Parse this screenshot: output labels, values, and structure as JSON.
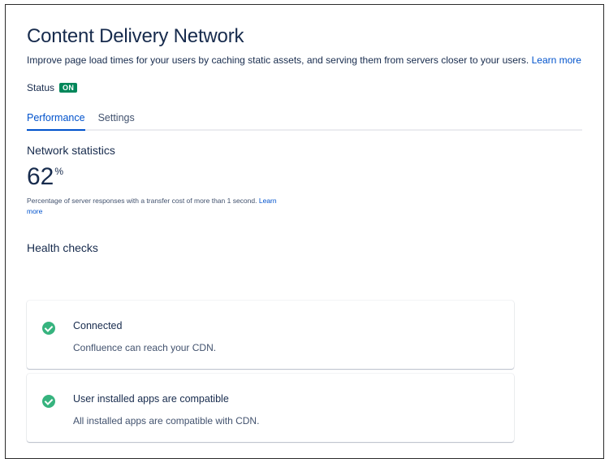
{
  "header": {
    "title": "Content Delivery Network",
    "description": "Improve page load times for your users by caching static assets, and serving them from servers closer to your users.",
    "learn_more": "Learn more"
  },
  "status": {
    "label": "Status",
    "value": "ON",
    "color": "#00875a"
  },
  "tabs": [
    {
      "label": "Performance",
      "active": true
    },
    {
      "label": "Settings",
      "active": false
    }
  ],
  "network_statistics": {
    "heading": "Network statistics",
    "value": "62",
    "unit": "%",
    "description": "Percentage of server responses with a transfer cost of more than 1 second.",
    "learn_more": "Learn more"
  },
  "health_checks": {
    "heading": "Health checks",
    "items": [
      {
        "title": "Connected",
        "description": "Confluence can reach your CDN.",
        "icon": "check-circle-icon",
        "color": "#36b37e"
      },
      {
        "title": "User installed apps are compatible",
        "description": "All installed apps are compatible with CDN.",
        "icon": "check-circle-icon",
        "color": "#36b37e"
      }
    ]
  },
  "colors": {
    "accent": "#0052cc",
    "text": "#172b4d"
  }
}
